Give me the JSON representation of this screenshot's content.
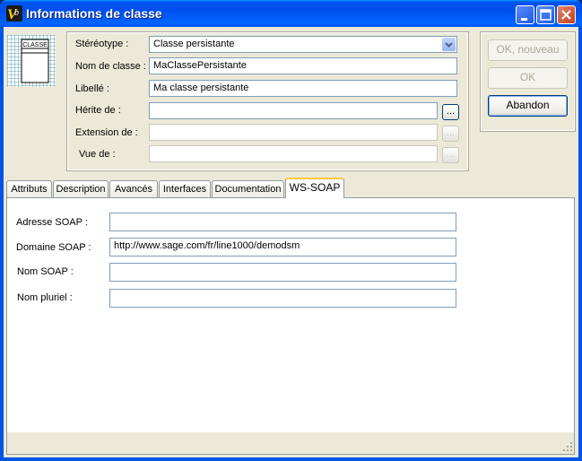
{
  "window": {
    "title": "Informations de classe",
    "icon": "app-vb-icon"
  },
  "class_icon": {
    "label": "CLASSE"
  },
  "form": {
    "stereotype_label": "Stéréotype :",
    "stereotype_value": "Classe persistante",
    "class_name_label": "Nom de classe :",
    "class_name_value": "MaClassePersistante",
    "libelle_label": "Libellé :",
    "libelle_value": "Ma classe persistante",
    "herite_label": "Hérite de :",
    "herite_value": "",
    "extension_label": "Extension de :",
    "extension_value": "",
    "vue_label": "Vue de :",
    "vue_value": "",
    "ellipsis": "..."
  },
  "buttons": {
    "ok_new": "OK, nouveau",
    "ok": "OK",
    "cancel": "Abandon"
  },
  "tabs": [
    {
      "label": "Attributs"
    },
    {
      "label": "Description"
    },
    {
      "label": "Avancés"
    },
    {
      "label": "Interfaces"
    },
    {
      "label": "Documentation"
    },
    {
      "label": "WS-SOAP"
    }
  ],
  "active_tab": "WS-SOAP",
  "soap": {
    "address_label": "Adresse SOAP :",
    "address_value": "",
    "domain_label": "Domaine SOAP :",
    "domain_value": "http://www.sage.com/fr/line1000/demodsm",
    "name_label": "Nom SOAP :",
    "name_value": "",
    "plural_label": "Nom pluriel :",
    "plural_value": ""
  }
}
